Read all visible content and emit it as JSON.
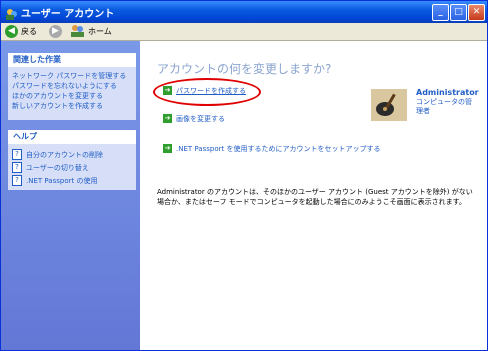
{
  "window": {
    "title": "ユーザー アカウント",
    "buttons": {
      "minimize": "_",
      "maximize": "□",
      "close": "✕"
    }
  },
  "toolbar": {
    "back_label": "戻る",
    "home_label": "ホーム",
    "back_glyph": "◀",
    "forward_glyph": "▶"
  },
  "sidebar": {
    "tasks_title": "関連した作業",
    "tasks": [
      "ネットワーク パスワードを管理する",
      "パスワードを忘れないようにする",
      "ほかのアカウントを変更する",
      "新しいアカウントを作成する"
    ],
    "help_title": "ヘルプ",
    "help_items": [
      "自分のアカウントの削除",
      "ユーザーの切り替え",
      ".NET Passport の使用"
    ],
    "help_glyph": "?"
  },
  "main": {
    "heading": "アカウントの何を変更しますか?",
    "arrow_glyph": "➔",
    "links": {
      "create_password": "パスワードを作成する",
      "change_picture": "画像を変更する",
      "net_passport": ".NET Passport を使用するためにアカウントをセットアップする"
    },
    "user": {
      "name": "Administrator",
      "type": "コンピュータの管理者"
    },
    "note": "Administrator のアカウントは、そのほかのユーザー アカウント (Guest アカウントを除外) がない場合か、またはセーフ モードでコンピュータを起動した場合にのみようこそ画面に表示されます。"
  },
  "colors": {
    "link": "#215dc6",
    "annotation_oval": "#e00000",
    "sidebar_bg": "#6f88de"
  }
}
